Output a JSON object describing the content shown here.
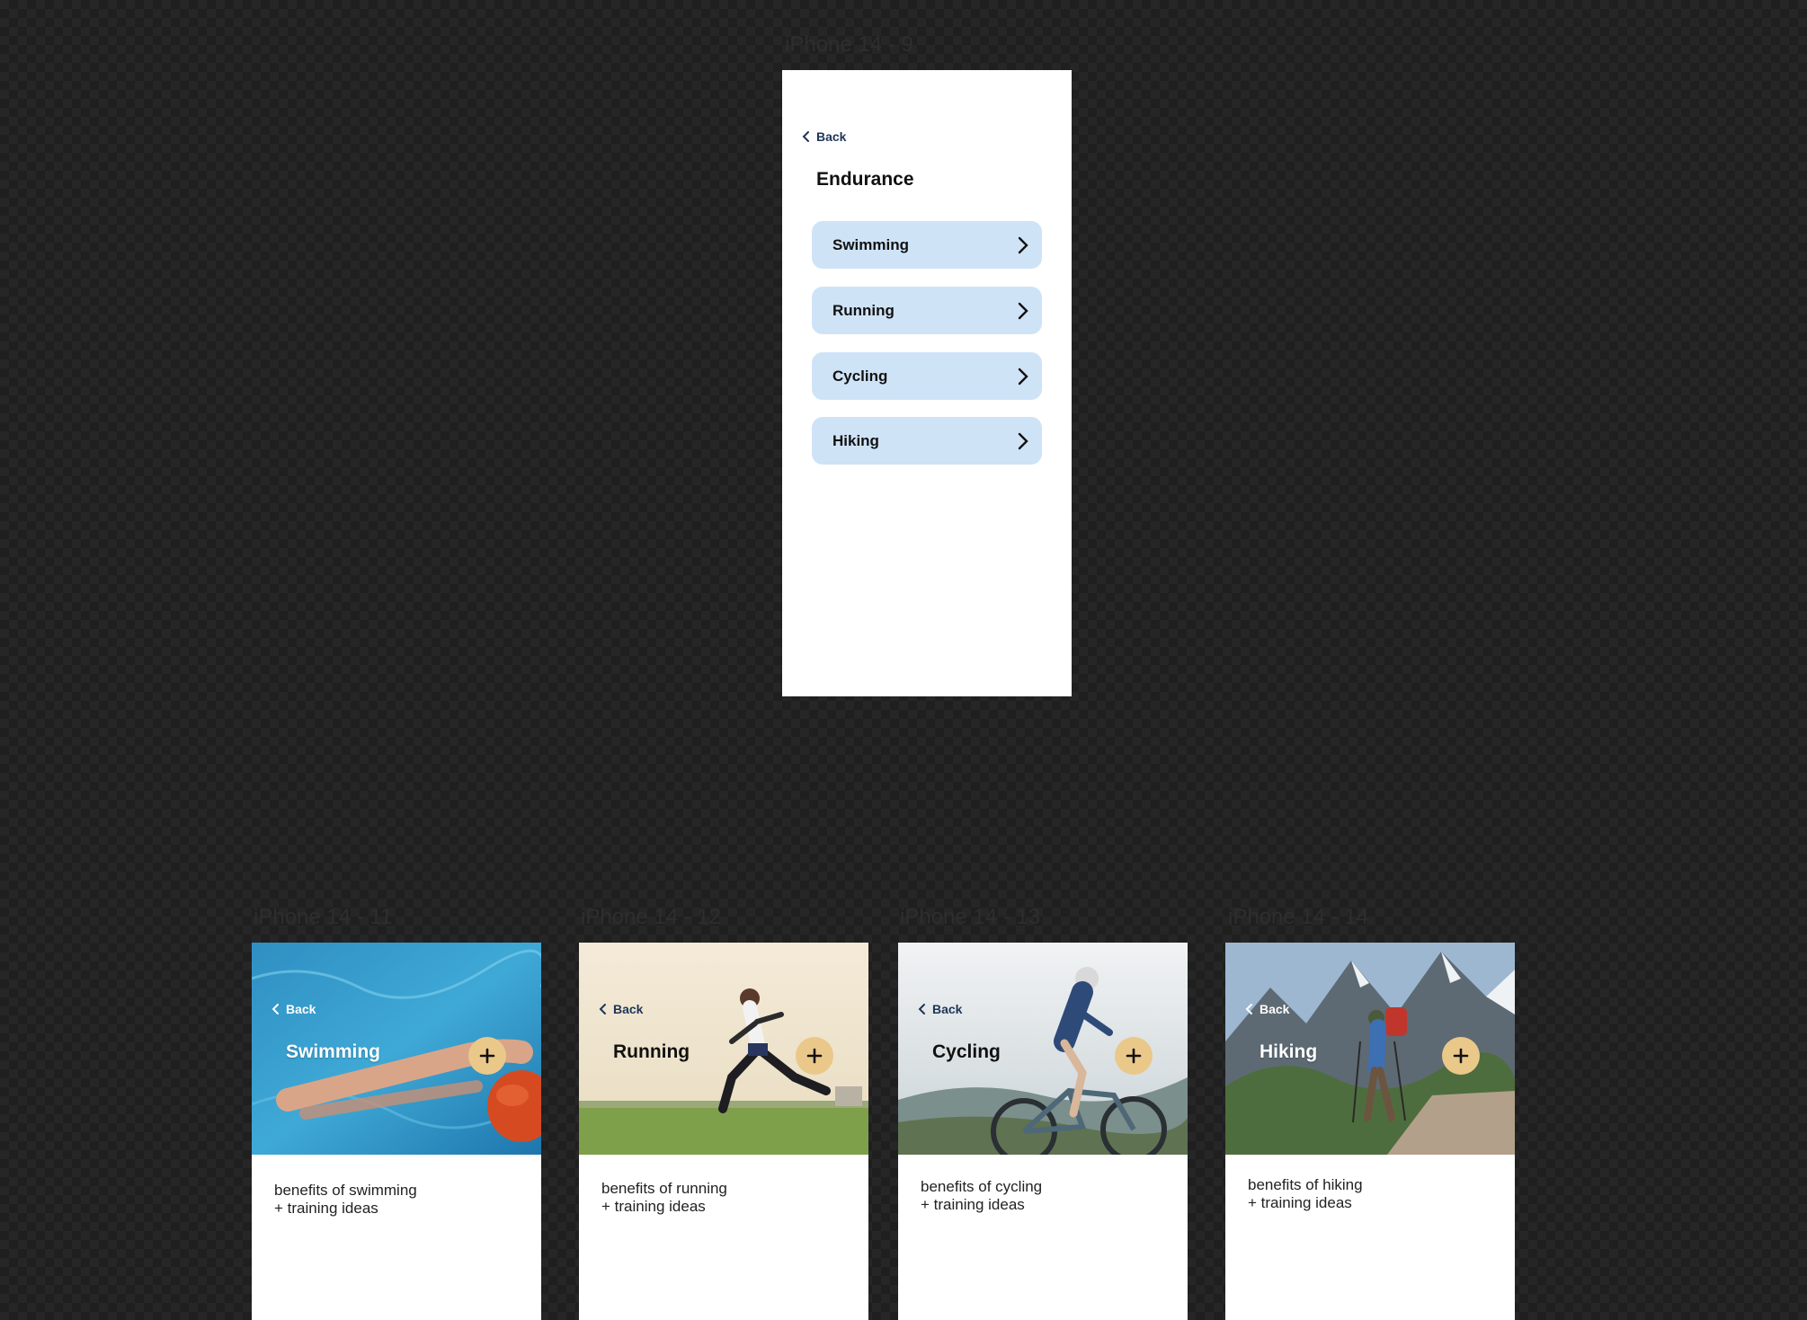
{
  "frames": {
    "main_label": "iPhone 14 - 9",
    "card_labels": [
      "iPhone 14 - 11",
      "iPhone 14 - 12",
      "iPhone 14 - 13",
      "iPhone 14 - 14"
    ]
  },
  "main": {
    "back_label": "Back",
    "title": "Endurance",
    "items": [
      {
        "label": "Swimming"
      },
      {
        "label": "Running"
      },
      {
        "label": "Cycling"
      },
      {
        "label": "Hiking"
      }
    ]
  },
  "cards": [
    {
      "back_label": "Back",
      "title": "Swimming",
      "desc_line1": "benefits of swimming",
      "desc_line2": "+ training ideas"
    },
    {
      "back_label": "Back",
      "title": "Running",
      "desc_line1": "benefits of running",
      "desc_line2": "+ training ideas"
    },
    {
      "back_label": "Back",
      "title": "Cycling",
      "desc_line1": "benefits of cycling",
      "desc_line2": "+ training ideas"
    },
    {
      "back_label": "Back",
      "title": "Hiking",
      "desc_line1": "benefits of hiking",
      "desc_line2": "+ training ideas"
    }
  ],
  "colors": {
    "list_item_bg": "#cfe3f7",
    "add_button_bg": "#eac88a",
    "back_text": "#1d3557"
  },
  "icons": [
    "chevron-left-icon",
    "chevron-right-icon",
    "plus-icon"
  ]
}
